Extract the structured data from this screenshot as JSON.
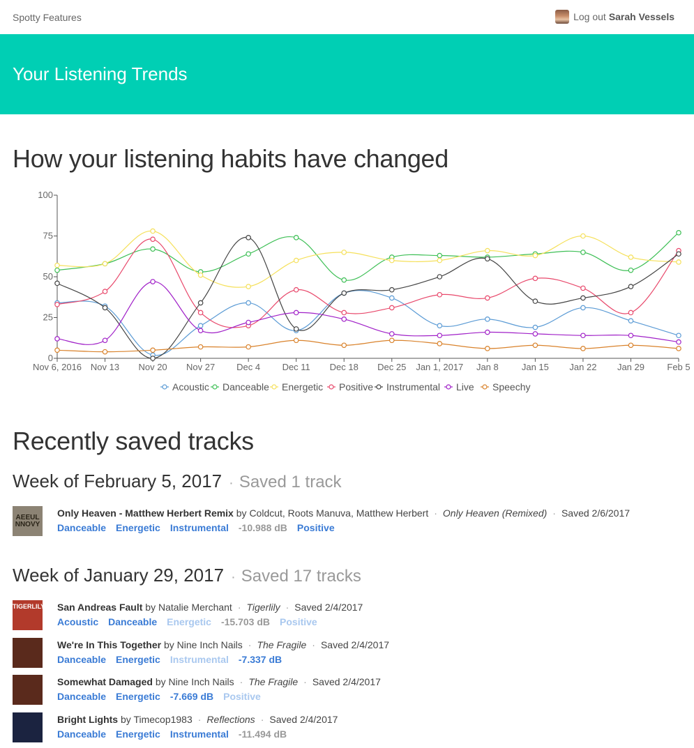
{
  "topbar": {
    "brand": "Spotty Features",
    "logout_label": "Log out",
    "username": "Sarah Vessels"
  },
  "hero": {
    "title": "Your Listening Trends"
  },
  "chart_section": {
    "title": "How your listening habits have changed"
  },
  "chart_data": {
    "type": "line",
    "x": [
      "Nov 6, 2016",
      "Nov 13",
      "Nov 20",
      "Nov 27",
      "Dec 4",
      "Dec 11",
      "Dec 18",
      "Dec 25",
      "Jan 1, 2017",
      "Jan 8",
      "Jan 15",
      "Jan 22",
      "Jan 29",
      "Feb 5"
    ],
    "ylim": [
      0,
      100
    ],
    "yticks": [
      0,
      25,
      50,
      75,
      100
    ],
    "grid": false,
    "legend": "bottom",
    "series": [
      {
        "name": "Acoustic",
        "color": "#5b9bd5",
        "values": [
          34,
          32,
          2,
          20,
          34,
          17,
          40,
          37,
          20,
          24,
          19,
          31,
          23,
          14
        ]
      },
      {
        "name": "Danceable",
        "color": "#3dbf55",
        "values": [
          54,
          58,
          67,
          53,
          64,
          74,
          48,
          62,
          63,
          62,
          64,
          65,
          54,
          77
        ]
      },
      {
        "name": "Energetic",
        "color": "#f5e05a",
        "values": [
          57,
          58,
          78,
          51,
          44,
          60,
          65,
          60,
          60,
          66,
          63,
          75,
          62,
          59
        ]
      },
      {
        "name": "Positive",
        "color": "#e8486b",
        "values": [
          33,
          41,
          73,
          28,
          20,
          42,
          28,
          31,
          39,
          37,
          49,
          43,
          28,
          66
        ]
      },
      {
        "name": "Instrumental",
        "color": "#444444",
        "values": [
          46,
          31,
          0,
          34,
          74,
          18,
          40,
          42,
          50,
          61,
          35,
          37,
          44,
          64
        ]
      },
      {
        "name": "Live",
        "color": "#a020c8",
        "values": [
          12,
          11,
          47,
          17,
          22,
          28,
          24,
          15,
          14,
          16,
          15,
          14,
          14,
          10
        ]
      },
      {
        "name": "Speechy",
        "color": "#d9822b",
        "values": [
          5,
          4,
          5,
          7,
          7,
          11,
          8,
          11,
          9,
          6,
          8,
          6,
          8,
          6
        ]
      }
    ]
  },
  "tracks_section": {
    "title": "Recently saved tracks"
  },
  "weeks": [
    {
      "title": "Week of February 5, 2017",
      "count": "Saved 1 track",
      "tracks": [
        {
          "name": "Only Heaven - Matthew Herbert Remix",
          "by": "by",
          "artists": "Coldcut, Roots Manuva, Matthew Herbert",
          "album": "Only Heaven (Remixed)",
          "saved": "Saved 2/6/2017",
          "cover_color": "#8c8374",
          "cover_text": "AEEUL NNOVY",
          "tags": [
            {
              "label": "Danceable",
              "style": "strong"
            },
            {
              "label": "Energetic",
              "style": "strong"
            },
            {
              "label": "Instrumental",
              "style": "strong"
            },
            {
              "label": "-10.988 dB",
              "style": "db"
            },
            {
              "label": "Positive",
              "style": "strong"
            }
          ]
        }
      ]
    },
    {
      "title": "Week of January 29, 2017",
      "count": "Saved 17 tracks",
      "tracks": [
        {
          "name": "San Andreas Fault",
          "by": "by",
          "artists": "Natalie Merchant",
          "album": "Tigerlily",
          "saved": "Saved 2/4/2017",
          "cover_color": "#b23a2b",
          "cover_text": "TIGERLILY",
          "tags": [
            {
              "label": "Acoustic",
              "style": "strong"
            },
            {
              "label": "Danceable",
              "style": "strong"
            },
            {
              "label": "Energetic",
              "style": "faint"
            },
            {
              "label": "-15.703 dB",
              "style": "db"
            },
            {
              "label": "Positive",
              "style": "faint"
            }
          ]
        },
        {
          "name": "We're In This Together",
          "by": "by",
          "artists": "Nine Inch Nails",
          "album": "The Fragile",
          "saved": "Saved 2/4/2017",
          "cover_color": "#5a2a1c",
          "cover_text": "",
          "tags": [
            {
              "label": "Danceable",
              "style": "strong"
            },
            {
              "label": "Energetic",
              "style": "strong"
            },
            {
              "label": "Instrumental",
              "style": "faint"
            },
            {
              "label": "-7.337 dB",
              "style": "dbhi"
            }
          ]
        },
        {
          "name": "Somewhat Damaged",
          "by": "by",
          "artists": "Nine Inch Nails",
          "album": "The Fragile",
          "saved": "Saved 2/4/2017",
          "cover_color": "#5a2a1c",
          "cover_text": "",
          "tags": [
            {
              "label": "Danceable",
              "style": "strong"
            },
            {
              "label": "Energetic",
              "style": "strong"
            },
            {
              "label": "-7.669 dB",
              "style": "dbhi"
            },
            {
              "label": "Positive",
              "style": "faint"
            }
          ]
        },
        {
          "name": "Bright Lights",
          "by": "by",
          "artists": "Timecop1983",
          "album": "Reflections",
          "saved": "Saved 2/4/2017",
          "cover_color": "#1b2340",
          "cover_text": "",
          "tags": [
            {
              "label": "Danceable",
              "style": "strong"
            },
            {
              "label": "Energetic",
              "style": "strong"
            },
            {
              "label": "Instrumental",
              "style": "strong"
            },
            {
              "label": "-11.494 dB",
              "style": "db"
            }
          ]
        }
      ]
    }
  ]
}
